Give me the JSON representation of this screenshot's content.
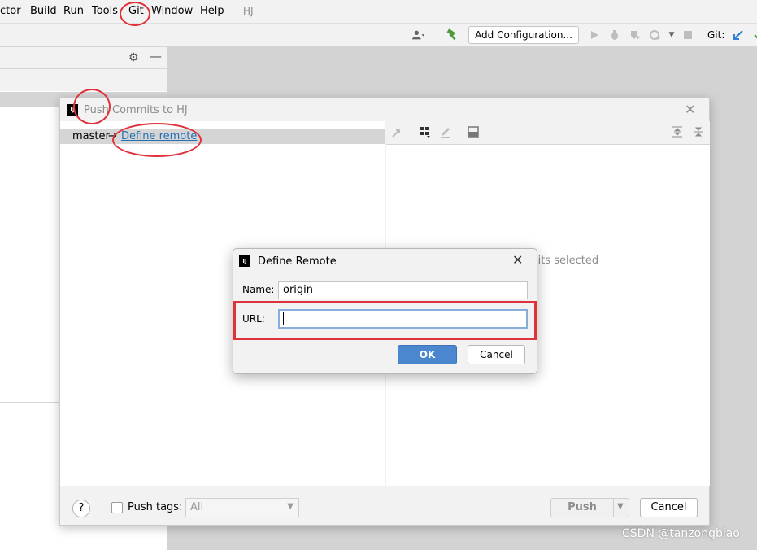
{
  "menubar": {
    "items": [
      "ctor",
      "Build",
      "Run",
      "Tools",
      "Git",
      "Window",
      "Help"
    ],
    "project": "HJ"
  },
  "toolbar": {
    "add_configuration": "Add Configuration...",
    "git_label": "Git:",
    "icons": [
      "user-icon",
      "build-hammer-icon",
      "run-icon",
      "debug-icon",
      "coverage-icon",
      "profile-icon",
      "stop-icon",
      "git-update-icon",
      "git-commit-icon"
    ]
  },
  "left_panel": {
    "icons": [
      "gear-icon",
      "minimize-icon"
    ]
  },
  "push_dialog": {
    "title": "Push Commits to HJ",
    "branch": "master",
    "separator": "→",
    "define_remote_link": "Define remote",
    "no_commits_text": "mits selected",
    "help_label": "?",
    "push_tags_label": "Push tags:",
    "push_tags_value": "All",
    "push_button": "Push",
    "cancel_button": "Cancel"
  },
  "define_remote_dialog": {
    "title": "Define Remote",
    "name_label": "Name:",
    "name_value": "origin",
    "url_label": "URL:",
    "url_value": "",
    "ok_button": "OK",
    "cancel_button": "Cancel"
  },
  "watermark": "CSDN @tanzongbiao",
  "annotation_color": "#e0323a"
}
